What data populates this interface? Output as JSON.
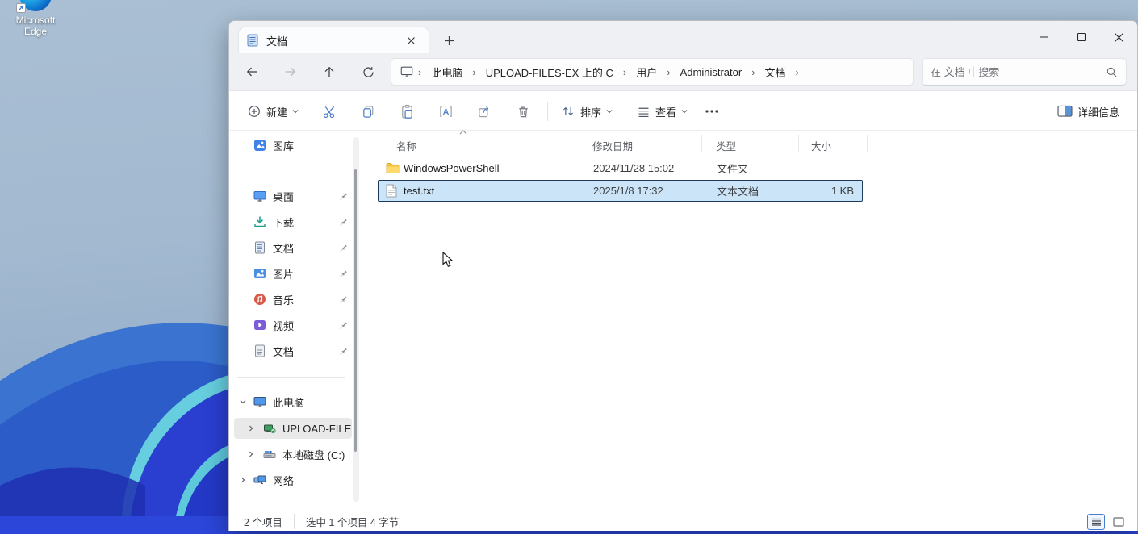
{
  "desktop": {
    "edge_shortcut_label": "Microsoft Edge"
  },
  "window": {
    "tab": {
      "title": "文档"
    },
    "breadcrumb": {
      "separator": "›",
      "items": [
        "此电脑",
        "UPLOAD-FILES-EX 上的 C",
        "用户",
        "Administrator",
        "文档"
      ]
    },
    "search": {
      "placeholder": "在 文档 中搜索"
    },
    "toolbar": {
      "new_label": "新建",
      "sort_label": "排序",
      "view_label": "查看",
      "details_label": "详细信息"
    },
    "sidebar": {
      "gallery": {
        "label": "图库"
      },
      "pinned": [
        {
          "label": "桌面",
          "icon": "desktop-icon"
        },
        {
          "label": "下载",
          "icon": "downloads-icon"
        },
        {
          "label": "文档",
          "icon": "documents-icon"
        },
        {
          "label": "图片",
          "icon": "pictures-icon"
        },
        {
          "label": "音乐",
          "icon": "music-icon"
        },
        {
          "label": "视频",
          "icon": "videos-icon"
        },
        {
          "label": "文档",
          "icon": "documents-icon"
        }
      ],
      "tree": [
        {
          "label": "此电脑",
          "expanded": true,
          "selected": false
        },
        {
          "label": "UPLOAD-FILES-",
          "expanded": false,
          "selected": true
        },
        {
          "label": "本地磁盘 (C:)",
          "expanded": false,
          "selected": false
        },
        {
          "label": "网络",
          "expanded": false,
          "selected": false
        }
      ]
    },
    "files": {
      "columns": [
        "名称",
        "修改日期",
        "类型",
        "大小"
      ],
      "rows": [
        {
          "name": "WindowsPowerShell",
          "date": "2024/11/28 15:02",
          "type": "文件夹",
          "size": "",
          "icon": "folder-icon",
          "selected": false
        },
        {
          "name": "test.txt",
          "date": "2025/1/8 17:32",
          "type": "文本文档",
          "size": "1 KB",
          "icon": "text-file-icon",
          "selected": true
        }
      ]
    },
    "statusbar": {
      "item_count": "2 个项目",
      "selection_info": "选中 1 个项目  4 字节"
    }
  },
  "colors": {
    "selection_fill": "#cce4f7",
    "selection_border": "#1e3a5c",
    "mica": "#eef0f4",
    "wallpaper_bottom_blue": "#2b46d8"
  }
}
